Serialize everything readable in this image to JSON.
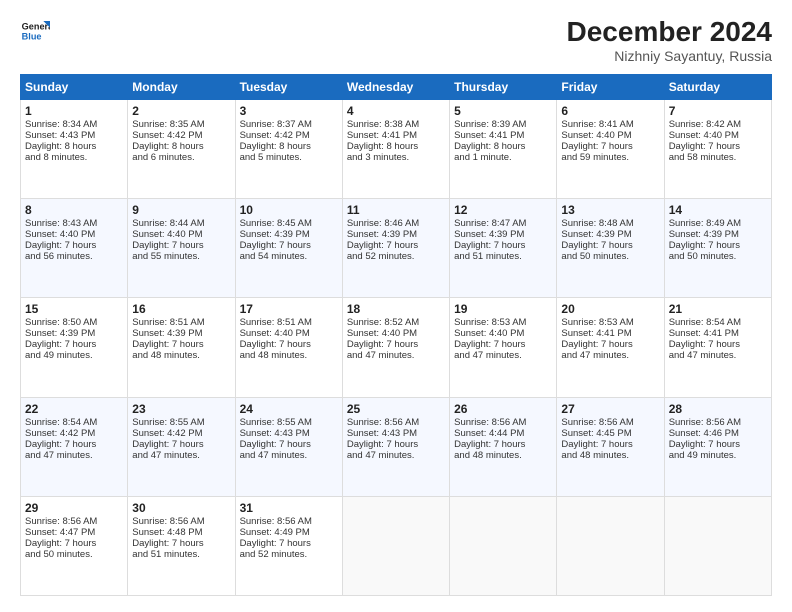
{
  "header": {
    "logo_line1": "General",
    "logo_line2": "Blue",
    "title": "December 2024",
    "subtitle": "Nizhniy Sayantuy, Russia"
  },
  "weekdays": [
    "Sunday",
    "Monday",
    "Tuesday",
    "Wednesday",
    "Thursday",
    "Friday",
    "Saturday"
  ],
  "weeks": [
    [
      {
        "day": 1,
        "lines": [
          "Sunrise: 8:34 AM",
          "Sunset: 4:43 PM",
          "Daylight: 8 hours",
          "and 8 minutes."
        ]
      },
      {
        "day": 2,
        "lines": [
          "Sunrise: 8:35 AM",
          "Sunset: 4:42 PM",
          "Daylight: 8 hours",
          "and 6 minutes."
        ]
      },
      {
        "day": 3,
        "lines": [
          "Sunrise: 8:37 AM",
          "Sunset: 4:42 PM",
          "Daylight: 8 hours",
          "and 5 minutes."
        ]
      },
      {
        "day": 4,
        "lines": [
          "Sunrise: 8:38 AM",
          "Sunset: 4:41 PM",
          "Daylight: 8 hours",
          "and 3 minutes."
        ]
      },
      {
        "day": 5,
        "lines": [
          "Sunrise: 8:39 AM",
          "Sunset: 4:41 PM",
          "Daylight: 8 hours",
          "and 1 minute."
        ]
      },
      {
        "day": 6,
        "lines": [
          "Sunrise: 8:41 AM",
          "Sunset: 4:40 PM",
          "Daylight: 7 hours",
          "and 59 minutes."
        ]
      },
      {
        "day": 7,
        "lines": [
          "Sunrise: 8:42 AM",
          "Sunset: 4:40 PM",
          "Daylight: 7 hours",
          "and 58 minutes."
        ]
      }
    ],
    [
      {
        "day": 8,
        "lines": [
          "Sunrise: 8:43 AM",
          "Sunset: 4:40 PM",
          "Daylight: 7 hours",
          "and 56 minutes."
        ]
      },
      {
        "day": 9,
        "lines": [
          "Sunrise: 8:44 AM",
          "Sunset: 4:40 PM",
          "Daylight: 7 hours",
          "and 55 minutes."
        ]
      },
      {
        "day": 10,
        "lines": [
          "Sunrise: 8:45 AM",
          "Sunset: 4:39 PM",
          "Daylight: 7 hours",
          "and 54 minutes."
        ]
      },
      {
        "day": 11,
        "lines": [
          "Sunrise: 8:46 AM",
          "Sunset: 4:39 PM",
          "Daylight: 7 hours",
          "and 52 minutes."
        ]
      },
      {
        "day": 12,
        "lines": [
          "Sunrise: 8:47 AM",
          "Sunset: 4:39 PM",
          "Daylight: 7 hours",
          "and 51 minutes."
        ]
      },
      {
        "day": 13,
        "lines": [
          "Sunrise: 8:48 AM",
          "Sunset: 4:39 PM",
          "Daylight: 7 hours",
          "and 50 minutes."
        ]
      },
      {
        "day": 14,
        "lines": [
          "Sunrise: 8:49 AM",
          "Sunset: 4:39 PM",
          "Daylight: 7 hours",
          "and 50 minutes."
        ]
      }
    ],
    [
      {
        "day": 15,
        "lines": [
          "Sunrise: 8:50 AM",
          "Sunset: 4:39 PM",
          "Daylight: 7 hours",
          "and 49 minutes."
        ]
      },
      {
        "day": 16,
        "lines": [
          "Sunrise: 8:51 AM",
          "Sunset: 4:39 PM",
          "Daylight: 7 hours",
          "and 48 minutes."
        ]
      },
      {
        "day": 17,
        "lines": [
          "Sunrise: 8:51 AM",
          "Sunset: 4:40 PM",
          "Daylight: 7 hours",
          "and 48 minutes."
        ]
      },
      {
        "day": 18,
        "lines": [
          "Sunrise: 8:52 AM",
          "Sunset: 4:40 PM",
          "Daylight: 7 hours",
          "and 47 minutes."
        ]
      },
      {
        "day": 19,
        "lines": [
          "Sunrise: 8:53 AM",
          "Sunset: 4:40 PM",
          "Daylight: 7 hours",
          "and 47 minutes."
        ]
      },
      {
        "day": 20,
        "lines": [
          "Sunrise: 8:53 AM",
          "Sunset: 4:41 PM",
          "Daylight: 7 hours",
          "and 47 minutes."
        ]
      },
      {
        "day": 21,
        "lines": [
          "Sunrise: 8:54 AM",
          "Sunset: 4:41 PM",
          "Daylight: 7 hours",
          "and 47 minutes."
        ]
      }
    ],
    [
      {
        "day": 22,
        "lines": [
          "Sunrise: 8:54 AM",
          "Sunset: 4:42 PM",
          "Daylight: 7 hours",
          "and 47 minutes."
        ]
      },
      {
        "day": 23,
        "lines": [
          "Sunrise: 8:55 AM",
          "Sunset: 4:42 PM",
          "Daylight: 7 hours",
          "and 47 minutes."
        ]
      },
      {
        "day": 24,
        "lines": [
          "Sunrise: 8:55 AM",
          "Sunset: 4:43 PM",
          "Daylight: 7 hours",
          "and 47 minutes."
        ]
      },
      {
        "day": 25,
        "lines": [
          "Sunrise: 8:56 AM",
          "Sunset: 4:43 PM",
          "Daylight: 7 hours",
          "and 47 minutes."
        ]
      },
      {
        "day": 26,
        "lines": [
          "Sunrise: 8:56 AM",
          "Sunset: 4:44 PM",
          "Daylight: 7 hours",
          "and 48 minutes."
        ]
      },
      {
        "day": 27,
        "lines": [
          "Sunrise: 8:56 AM",
          "Sunset: 4:45 PM",
          "Daylight: 7 hours",
          "and 48 minutes."
        ]
      },
      {
        "day": 28,
        "lines": [
          "Sunrise: 8:56 AM",
          "Sunset: 4:46 PM",
          "Daylight: 7 hours",
          "and 49 minutes."
        ]
      }
    ],
    [
      {
        "day": 29,
        "lines": [
          "Sunrise: 8:56 AM",
          "Sunset: 4:47 PM",
          "Daylight: 7 hours",
          "and 50 minutes."
        ]
      },
      {
        "day": 30,
        "lines": [
          "Sunrise: 8:56 AM",
          "Sunset: 4:48 PM",
          "Daylight: 7 hours",
          "and 51 minutes."
        ]
      },
      {
        "day": 31,
        "lines": [
          "Sunrise: 8:56 AM",
          "Sunset: 4:49 PM",
          "Daylight: 7 hours",
          "and 52 minutes."
        ]
      },
      null,
      null,
      null,
      null
    ]
  ]
}
